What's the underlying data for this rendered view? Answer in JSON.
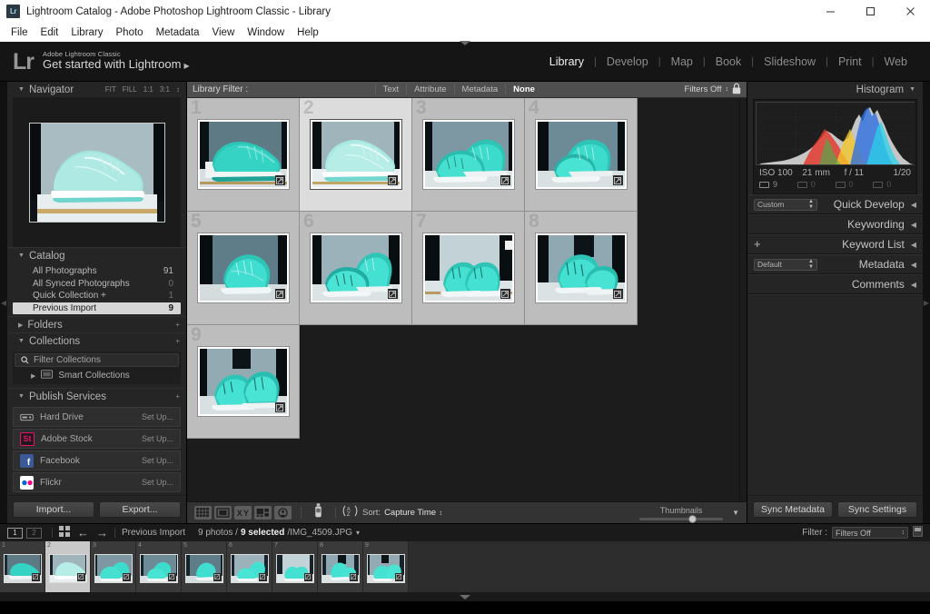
{
  "window": {
    "title": "Lightroom Catalog - Adobe Photoshop Lightroom Classic - Library",
    "app_badge": "Lr",
    "controls": {
      "minimize": "minimize-button",
      "maximize": "maximize-button",
      "close": "close-button"
    }
  },
  "menubar": {
    "items": [
      "File",
      "Edit",
      "Library",
      "Photo",
      "Metadata",
      "View",
      "Window",
      "Help"
    ]
  },
  "identity": {
    "logo": "Lr",
    "small_line": "Adobe Lightroom Classic",
    "big_line": "Get started with Lightroom",
    "arrow": "▶"
  },
  "modules": {
    "items": [
      "Library",
      "Develop",
      "Map",
      "Book",
      "Slideshow",
      "Print",
      "Web"
    ],
    "active": "Library",
    "separator": "|"
  },
  "left_panel": {
    "navigator": {
      "title": "Navigator",
      "twisty": "▼",
      "zoom_levels": [
        "FIT",
        "FILL",
        "1:1",
        "3:1"
      ],
      "stepper": "↕"
    },
    "catalog": {
      "title": "Catalog",
      "twisty": "▼",
      "rows": [
        {
          "label": "All Photographs",
          "count": "91",
          "selected": false
        },
        {
          "label": "All Synced Photographs",
          "count": "0",
          "selected": false
        },
        {
          "label": "Quick Collection +",
          "count": "1",
          "selected": false
        },
        {
          "label": "Previous Import",
          "count": "9",
          "selected": true
        }
      ]
    },
    "folders": {
      "title": "Folders",
      "twisty": "▶",
      "plus": "+"
    },
    "collections": {
      "title": "Collections",
      "twisty": "▼",
      "plus": "+",
      "filter_placeholder": "Filter Collections",
      "smart_collections": "Smart Collections",
      "smart_twisty": "▶"
    },
    "publish_services": {
      "title": "Publish Services",
      "twisty": "▼",
      "plus": "+",
      "services": [
        {
          "name": "Hard Drive",
          "action": "Set Up...",
          "icon": "hard-drive-icon",
          "color": "#9a9a9a"
        },
        {
          "name": "Adobe Stock",
          "action": "Set Up...",
          "icon": "adobe-stock-icon",
          "color": "#e8116b",
          "glyph": "St"
        },
        {
          "name": "Facebook",
          "action": "Set Up...",
          "icon": "facebook-icon",
          "color": "#3b5998",
          "glyph": "f"
        },
        {
          "name": "Flickr",
          "action": "Set Up...",
          "icon": "flickr-icon",
          "color": "#ffffff"
        }
      ]
    },
    "buttons": {
      "import": "Import...",
      "export": "Export..."
    }
  },
  "library_filter": {
    "label": "Library Filter :",
    "tabs": [
      "Text",
      "Attribute",
      "Metadata",
      "None"
    ],
    "active_tab": "None",
    "filters_state": "Filters Off",
    "stepper": "↕",
    "lock_icon": "lock-icon"
  },
  "grid": {
    "cells": [
      {
        "number": "1",
        "active": false,
        "badge": "crop-badge"
      },
      {
        "number": "2",
        "active": true,
        "badge": "crop-badge"
      },
      {
        "number": "3",
        "active": false,
        "badge": "crop-badge"
      },
      {
        "number": "4",
        "active": false,
        "badge": "crop-badge"
      },
      {
        "number": "5",
        "active": false,
        "badge": "crop-badge"
      },
      {
        "number": "6",
        "active": false,
        "badge": "crop-badge"
      },
      {
        "number": "7",
        "active": false,
        "badge": "crop-badge"
      },
      {
        "number": "8",
        "active": false,
        "badge": "crop-badge"
      },
      {
        "number": "9",
        "active": false,
        "badge": "crop-badge"
      }
    ]
  },
  "toolbar": {
    "view_icons": [
      "grid-view-icon",
      "loupe-view-icon",
      "compare-view-icon",
      "survey-view-icon",
      "people-view-icon"
    ],
    "paint_icon": "spray-can-icon",
    "sort_direction_icon": "az-sort-icon",
    "sort_label": "Sort:",
    "sort_value": "Capture Time",
    "sort_stepper": "↕",
    "thumbnails_label": "Thumbnails",
    "collapse_icon": "chevron-down-icon"
  },
  "right_panel": {
    "histogram": {
      "title": "Histogram",
      "twisty": "▼",
      "iso": "ISO 100",
      "focal": "21 mm",
      "aperture": "f / 11",
      "shutter": "1/20",
      "counts": [
        {
          "icon": "photo-count-icon",
          "value": "9",
          "dim": false
        },
        {
          "icon": "video-count-icon",
          "value": "0",
          "dim": true
        },
        {
          "icon": "raw-count-icon",
          "value": "0",
          "dim": true
        },
        {
          "icon": "stack-count-icon",
          "value": "0",
          "dim": true
        }
      ]
    },
    "sections": [
      {
        "title": "Quick Develop",
        "arrow": "◀",
        "combo": "Custom",
        "plus": null
      },
      {
        "title": "Keywording",
        "arrow": "◀",
        "combo": null,
        "plus": null
      },
      {
        "title": "Keyword List",
        "arrow": "◀",
        "combo": null,
        "plus": "+"
      },
      {
        "title": "Metadata",
        "arrow": "◀",
        "combo": "Default",
        "plus": null
      },
      {
        "title": "Comments",
        "arrow": "◀",
        "combo": null,
        "plus": null
      }
    ],
    "buttons": {
      "sync_metadata": "Sync Metadata",
      "sync_settings": "Sync Settings"
    }
  },
  "filmstrip_bar": {
    "screen1": "1",
    "screen2": "2",
    "grid_icon": "filmstrip-grid-icon",
    "back_icon": "←",
    "forward_icon": "→",
    "source": "Previous Import",
    "photo_count": "9 photos /",
    "selected_count": "9 selected",
    "filename": "/IMG_4509.JPG",
    "filename_caret": "▾",
    "filter_label": "Filter :",
    "filter_value": "Filters Off",
    "filter_stepper": "↕"
  },
  "filmstrip": {
    "cells": [
      {
        "number": "1",
        "active": false
      },
      {
        "number": "2",
        "active": true
      },
      {
        "number": "3",
        "active": false
      },
      {
        "number": "4",
        "active": false
      },
      {
        "number": "5",
        "active": false
      },
      {
        "number": "6",
        "active": false
      },
      {
        "number": "7",
        "active": false
      },
      {
        "number": "8",
        "active": false
      },
      {
        "number": "9",
        "active": false
      }
    ]
  },
  "colors": {
    "panel_bg": "#252525",
    "grid_cell": "#bdbdbd",
    "grid_cell_active": "#dcdcdc",
    "filter_bar": "#4f4f4f",
    "accent_text": "#f2f2f2",
    "stock_pink": "#e8116b",
    "facebook_blue": "#3b5998"
  }
}
